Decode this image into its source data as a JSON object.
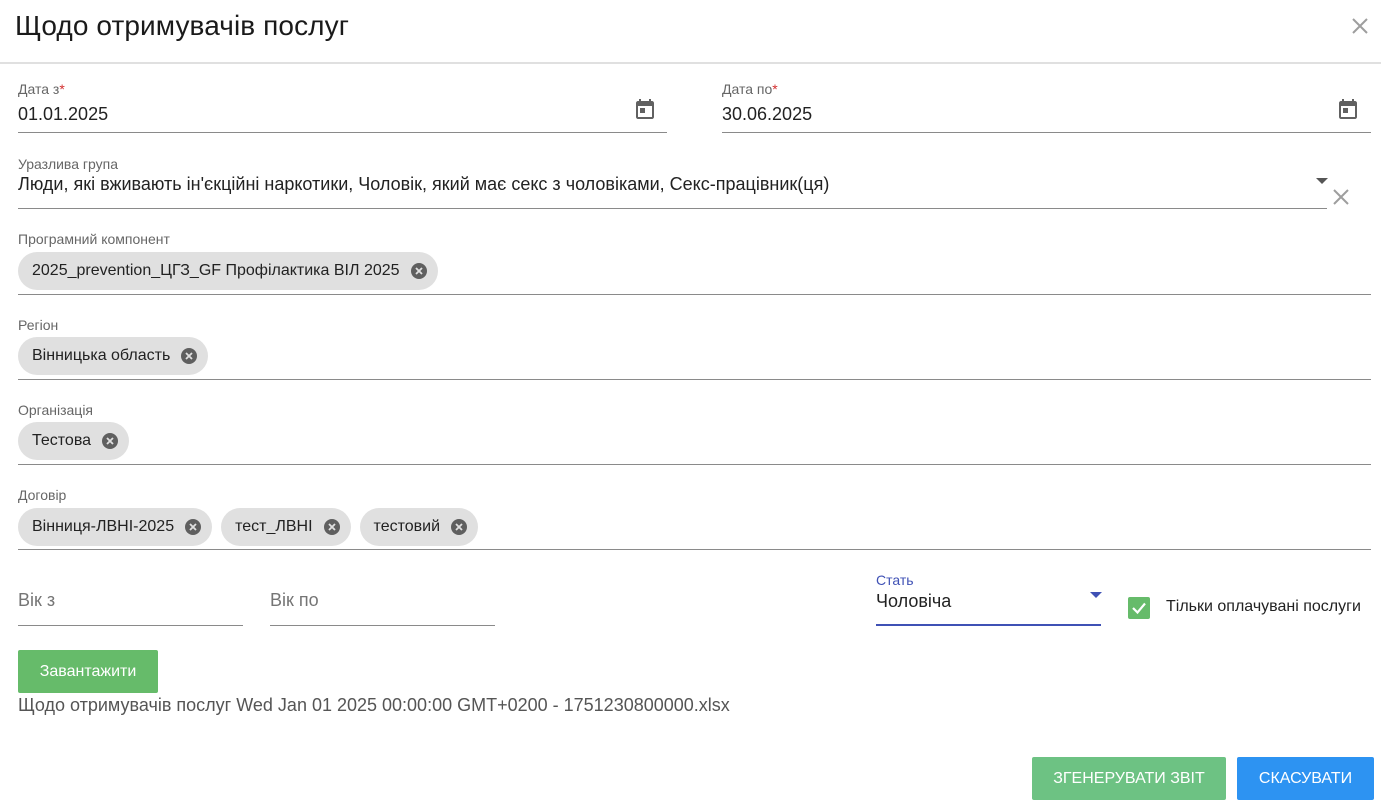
{
  "dialog": {
    "title": "Щодо отримувачів послуг"
  },
  "date_from": {
    "label": "Дата з",
    "required_mark": "*",
    "value": "01.01.2025"
  },
  "date_to": {
    "label": "Дата по",
    "required_mark": "*",
    "value": "30.06.2025"
  },
  "vulnerable_group": {
    "label": "Уразлива група",
    "value": "Люди, які вживають ін'єкційні наркотики, Чоловік, який має секс з чоловіками, Секс-працівник(ця)"
  },
  "program_component": {
    "label": "Програмний компонент",
    "chips": [
      "2025_prevention_ЦГЗ_GF Профілактика ВІЛ 2025"
    ]
  },
  "region": {
    "label": "Регіон",
    "chips": [
      "Вінницька область"
    ]
  },
  "organization": {
    "label": "Організація",
    "chips": [
      "Тестова"
    ]
  },
  "contract": {
    "label": "Договір",
    "chips": [
      "Вінниця-ЛВНІ-2025",
      "тест_ЛВНІ",
      "тестовий"
    ]
  },
  "age_from": {
    "placeholder": "Вік з"
  },
  "age_to": {
    "placeholder": "Вік по"
  },
  "sex": {
    "label": "Стать",
    "value": "Чоловіча"
  },
  "paid_only": {
    "label": "Тільки оплачувані послуги",
    "checked": true
  },
  "actions": {
    "load_label": "Завантажити",
    "generate_label": "ЗГЕНЕРУВАТИ ЗВІТ",
    "cancel_label": "СКАСУВАТИ"
  },
  "file_link": "Щодо отримувачів послуг Wed Jan 01 2025 00:00:00 GMT+0200 - 1751230800000.xlsx",
  "colors": {
    "green": "#66bb6a",
    "blue": "#2d93f2",
    "focus_underline": "#3f51b5",
    "required": "#d32f2f"
  }
}
